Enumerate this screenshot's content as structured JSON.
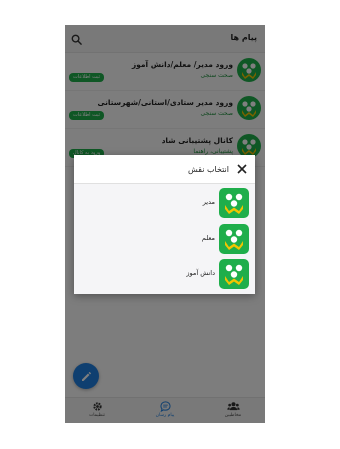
{
  "header": {
    "title": "پیام ها",
    "search_icon": "search-icon"
  },
  "chats": [
    {
      "title": "ورود مدیر/ معلم/دانش آموز",
      "subtitle": "صحت سنجی",
      "badge": "ثبت اطلاعات"
    },
    {
      "title": "ورود مدیر ستادی/استانی/شهرستانی",
      "subtitle": "صحت سنجی",
      "badge": "ثبت اطلاعات"
    },
    {
      "title": "کانال پشتیبانی شاد",
      "subtitle": "پشتیبانی، راهنما",
      "badge": "ورود به کانال"
    }
  ],
  "fab": {
    "icon": "pencil-icon"
  },
  "bottom_nav": [
    {
      "label": "تنظیمات",
      "icon": "gear-icon"
    },
    {
      "label": "پیام رسان",
      "icon": "chat-bubble-icon"
    },
    {
      "label": "مخاطبین",
      "icon": "contacts-icon"
    }
  ],
  "dialog": {
    "title": "انتخاب نقش",
    "close_icon": "close-icon",
    "roles": [
      {
        "label": "مدیر"
      },
      {
        "label": "معلم"
      },
      {
        "label": "دانش آموز"
      }
    ]
  },
  "colors": {
    "accent": "#1e7fe0",
    "brand_green": "#1fae4b",
    "logo_yellow": "#f2c500",
    "overlay": "rgba(0,0,0,0.5)"
  }
}
